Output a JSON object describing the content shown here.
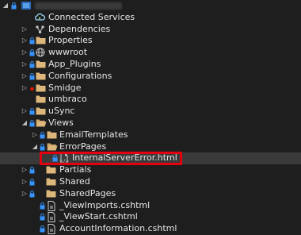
{
  "tree": {
    "items": [
      {
        "label": "Connected Services",
        "icon": "connected-services-icon"
      },
      {
        "label": "Dependencies",
        "icon": "dependencies-icon"
      },
      {
        "label": "Properties",
        "icon": "folder-icon"
      },
      {
        "label": "wwwroot",
        "icon": "globe-icon"
      },
      {
        "label": "App_Plugins",
        "icon": "folder-icon"
      },
      {
        "label": "Configurations",
        "icon": "folder-icon"
      },
      {
        "label": "Smidge",
        "icon": "folder-icon"
      },
      {
        "label": "umbraco",
        "icon": "folder-icon"
      },
      {
        "label": "uSync",
        "icon": "folder-icon"
      },
      {
        "label": "Views",
        "icon": "folder-open-icon"
      },
      {
        "label": "EmailTemplates",
        "icon": "folder-icon"
      },
      {
        "label": "ErrorPages",
        "icon": "folder-open-icon"
      },
      {
        "label": "InternalServerError.html",
        "icon": "html-file-icon"
      },
      {
        "label": "Partials",
        "icon": "folder-icon"
      },
      {
        "label": "Shared",
        "icon": "folder-icon"
      },
      {
        "label": "SharedPages",
        "icon": "folder-icon"
      },
      {
        "label": "_ViewImports.cshtml",
        "icon": "razor-file-icon"
      },
      {
        "label": "_ViewStart.cshtml",
        "icon": "razor-file-icon"
      },
      {
        "label": "AccountInformation.cshtml",
        "icon": "razor-file-icon"
      }
    ]
  },
  "colors": {
    "folder": "#dcb67a",
    "highlight": "#e3000f",
    "lock": "#3794ff",
    "red_dot": "#e51400"
  }
}
